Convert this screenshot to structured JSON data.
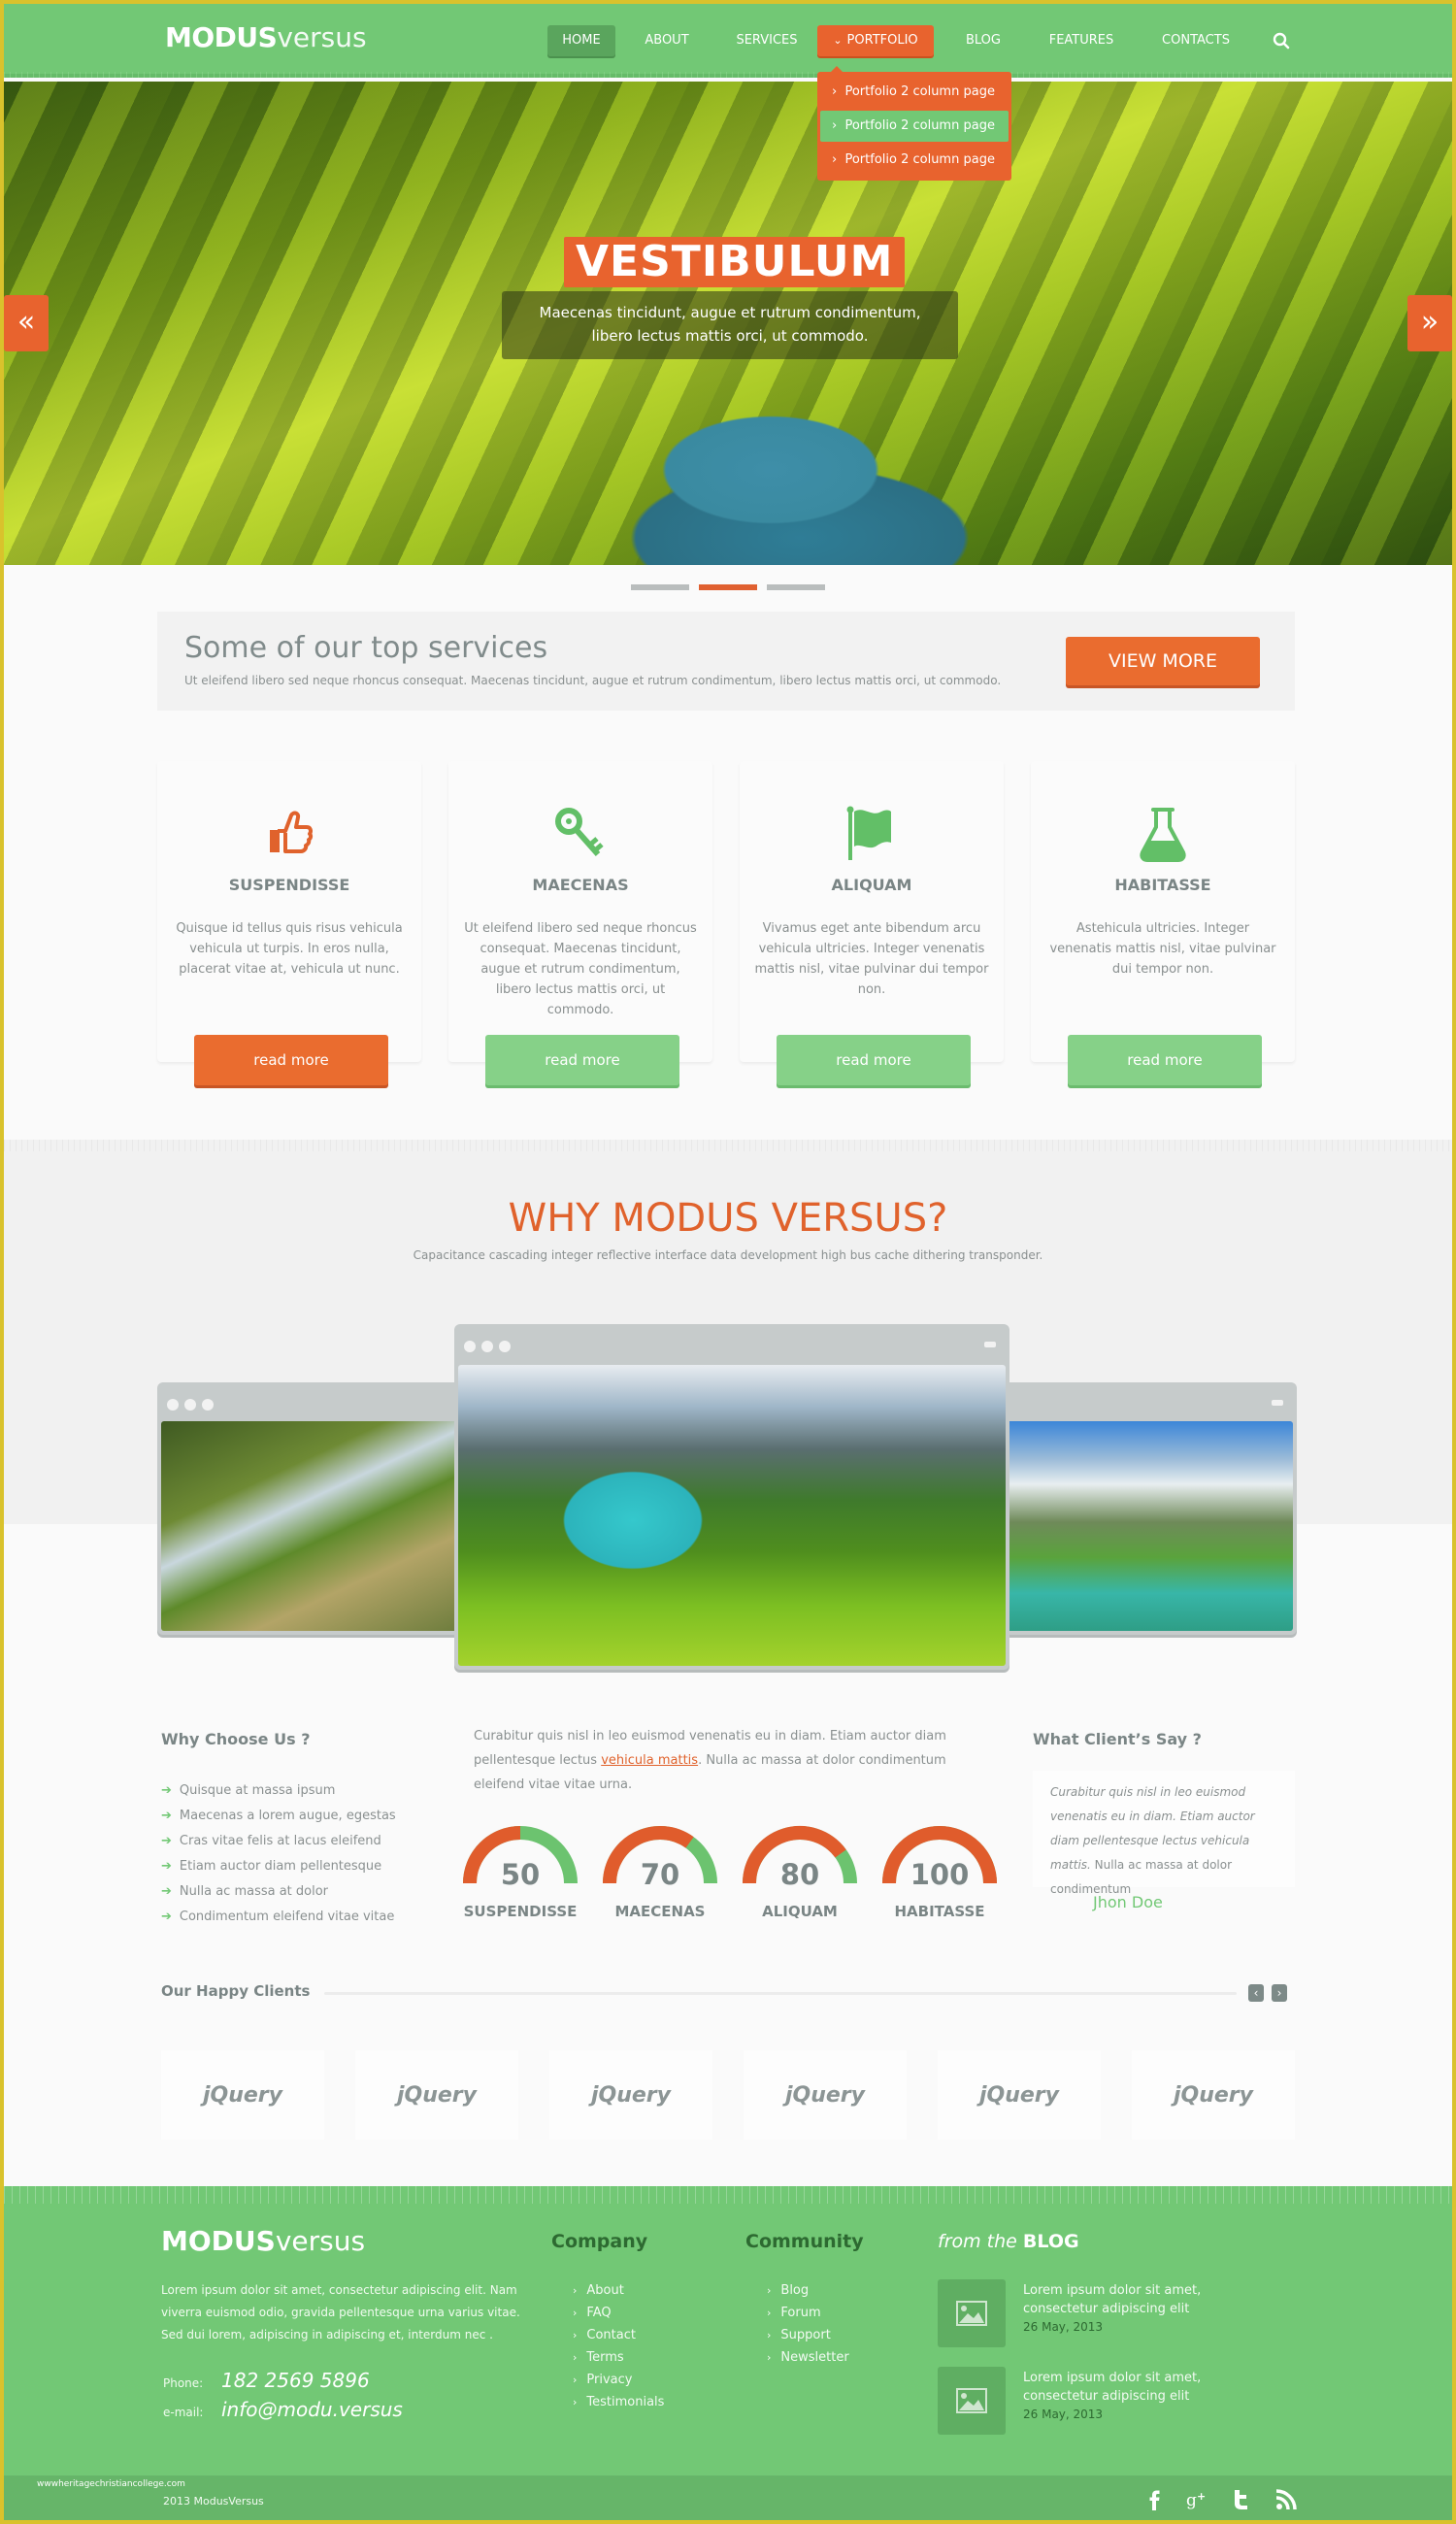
{
  "brand": {
    "bold": "MODUS",
    "light": "versus"
  },
  "nav": {
    "items": [
      {
        "label": "HOME",
        "state": "active"
      },
      {
        "label": "ABOUT",
        "state": ""
      },
      {
        "label": "SERVICES",
        "state": ""
      },
      {
        "label": "PORTFOLIO",
        "state": "open",
        "caret": "⌄"
      },
      {
        "label": "BLOG",
        "state": ""
      },
      {
        "label": "FEATURES",
        "state": ""
      },
      {
        "label": "CONTACTS",
        "state": ""
      }
    ],
    "search_icon": "search-icon",
    "dropdown": [
      {
        "label": "Portfolio 2 column page",
        "highlighted": false
      },
      {
        "label": "Portfolio 2 column page",
        "highlighted": true
      },
      {
        "label": "Portfolio 2 column page",
        "highlighted": false
      }
    ]
  },
  "hero": {
    "title": "VESTIBULUM",
    "subtitle_line1": "Maecenas tincidunt, augue et rutrum condimentum,",
    "subtitle_line2": "libero lectus mattis orci, ut commodo.",
    "prev_icon": "«",
    "next_icon": "»",
    "slides": 3,
    "active_slide": 2
  },
  "services_banner": {
    "title": "Some of our top services",
    "text": "Ut eleifend libero sed neque rhoncus consequat. Maecenas tincidunt, augue et rutrum condimentum, libero lectus mattis orci, ut commodo.",
    "button": "VIEW MORE"
  },
  "services": [
    {
      "icon": "thumbs-up-icon",
      "title": "SUSPENDISSE",
      "text": "Quisque id tellus quis risus vehicula vehicula ut turpis. In eros nulla, placerat vitae at, vehicula ut nunc.",
      "button": "read more",
      "color": "#e8632e"
    },
    {
      "icon": "key-icon",
      "title": "MAECENAS",
      "text": "Ut eleifend libero sed neque rhoncus consequat. Maecenas tincidunt, augue et rutrum condimentum, libero lectus mattis orci, ut commodo.",
      "button": "read more",
      "color": "#72c875"
    },
    {
      "icon": "flag-icon",
      "title": "ALIQUAM",
      "text": "Vivamus eget ante bibendum arcu vehicula ultricies. Integer venenatis mattis nisl, vitae pulvinar dui tempor non.",
      "button": "read more",
      "color": "#72c875"
    },
    {
      "icon": "flask-icon",
      "title": "HABITASSE",
      "text": "Astehicula ultricies. Integer venenatis mattis nisl, vitae pulvinar dui tempor non.",
      "button": "read more",
      "color": "#72c875"
    }
  ],
  "why": {
    "title": "WHY MODUS VERSUS?",
    "subtitle": "Capacitance cascading integer reflective interface data development high bus cache dithering transponder."
  },
  "why_choose": {
    "heading": "Why Choose Us ?",
    "items": [
      "Quisque at massa ipsum",
      "Maecenas a lorem augue, egestas",
      "Cras vitae felis at lacus eleifend",
      "Etiam auctor diam pellentesque",
      "Nulla ac massa at dolor",
      "Condimentum eleifend vitae vitae"
    ]
  },
  "middle": {
    "text_before": "Curabitur quis nisl in leo euismod venenatis eu in diam. Etiam auctor diam pellentesque lectus ",
    "link": "vehicula mattis",
    "text_after": ". Nulla ac massa at dolor condimentum eleifend vitae vitae urna."
  },
  "gauges": [
    {
      "value": 50,
      "label": "SUSPENDISSE"
    },
    {
      "value": 70,
      "label": "MAECENAS"
    },
    {
      "value": 80,
      "label": "ALIQUAM"
    },
    {
      "value": 100,
      "label": "HABITASSE"
    }
  ],
  "colors": {
    "orange": "#e8632e",
    "green": "#72c875",
    "dark_green": "#2d6a31",
    "gray_text": "#7a8585"
  },
  "testimonial": {
    "heading": "What Client’s Say ?",
    "italic": "Curabitur quis nisl in leo euismod venenatis eu in diam. Etiam auctor diam pellentesque lectus vehicula mattis.",
    "plain": " Nulla ac massa at dolor condimentum",
    "author": "Jhon Doe"
  },
  "clients": {
    "heading": "Our Happy Clients",
    "prev": "‹",
    "next": "›",
    "logos": [
      "jQuery",
      "jQuery",
      "jQuery",
      "jQuery",
      "jQuery",
      "jQuery"
    ]
  },
  "footer": {
    "about": "Lorem ipsum dolor sit amet, consectetur adipiscing elit. Nam viverra euismod odio, gravida pellentesque urna varius vitae. Sed dui lorem, adipiscing in adipiscing et, interdum nec .",
    "phone_label": "Phone:",
    "phone": "182 2569 5896",
    "email_label": "e-mail:",
    "email": "info@modu.versus",
    "company_heading": "Company",
    "company_links": [
      "About",
      "FAQ",
      "Contact",
      "Terms",
      "Privacy",
      "Testimonials"
    ],
    "community_heading": "Community",
    "community_links": [
      "Blog",
      "Forum",
      "Support",
      "Newsletter"
    ],
    "blog_heading_italic": "from the",
    "blog_heading_bold": "BLOG",
    "blog_posts": [
      {
        "title": "Lorem ipsum dolor sit amet, consectetur adipiscing elit",
        "date": "26 May, 2013"
      },
      {
        "title": "Lorem ipsum dolor sit amet, consectetur adipiscing elit",
        "date": "26 May, 2013"
      }
    ],
    "copyright": "2013  ModusVersus",
    "watermark": "wwwheritagechristiancollege.com",
    "social": [
      "facebook-icon",
      "google-plus-icon",
      "twitter-icon",
      "rss-icon"
    ]
  }
}
